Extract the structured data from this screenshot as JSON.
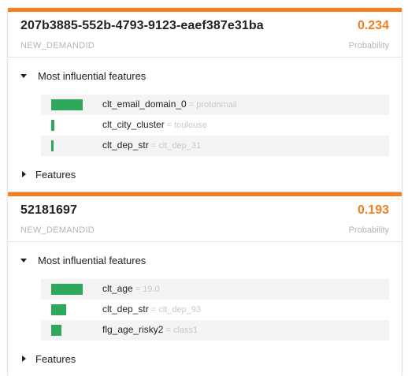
{
  "cards": [
    {
      "row_id": "207b3885-552b-4793-9123-eaef387e31ba",
      "id_label": "NEW_DEMANDID",
      "probability": "0.234",
      "probability_label": "Probability",
      "influential_label": "Most influential features",
      "features_label": "Features",
      "features": [
        {
          "name": "clt_email_domain_0",
          "eq": " = ",
          "value": "protonmail",
          "weight": 0.77
        },
        {
          "name": "clt_city_cluster",
          "eq": " = ",
          "value": "toulouse",
          "weight": 0.08
        },
        {
          "name": "clt_dep_str",
          "eq": " = ",
          "value": "clt_dep_31",
          "weight": 0.06
        }
      ]
    },
    {
      "row_id": "52181697",
      "id_label": "NEW_DEMANDID",
      "probability": "0.193",
      "probability_label": "Probability",
      "influential_label": "Most influential features",
      "features_label": "Features",
      "features": [
        {
          "name": "clt_age",
          "eq": " = ",
          "value": "19.0",
          "weight": 0.77
        },
        {
          "name": "clt_dep_str",
          "eq": " = ",
          "value": "clt_dep_93",
          "weight": 0.37
        },
        {
          "name": "flg_age_risky2",
          "eq": " = ",
          "value": "class1",
          "weight": 0.25
        }
      ]
    }
  ],
  "colors": {
    "accent": "#f47e20",
    "bar": "#2ea85a",
    "muted": "#b5b5b5"
  },
  "icons": {
    "expanded": "caret-down-icon",
    "collapsed": "caret-right-icon"
  }
}
